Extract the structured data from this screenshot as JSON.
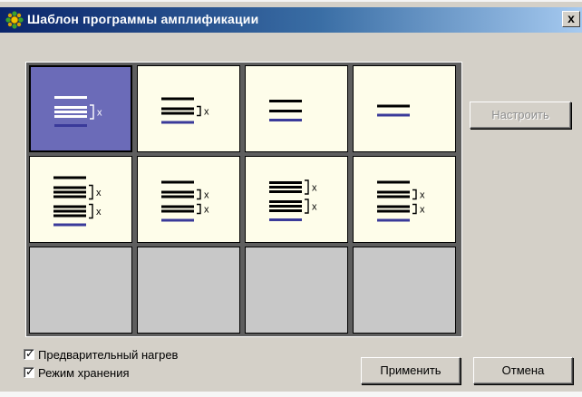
{
  "window": {
    "title": "Шаблон программы амплификации",
    "close_glyph": "x"
  },
  "templates": [
    {
      "id": "t1",
      "selected": true,
      "lines": [
        1,
        3
      ],
      "brackets": [
        1
      ]
    },
    {
      "id": "t2",
      "selected": false,
      "lines": [
        1,
        2
      ],
      "brackets": [
        1
      ]
    },
    {
      "id": "t3",
      "selected": false,
      "lines": [
        1,
        1
      ],
      "brackets": []
    },
    {
      "id": "t4",
      "selected": false,
      "lines": [
        1
      ],
      "brackets": []
    },
    {
      "id": "t5",
      "selected": false,
      "lines": [
        1,
        3,
        3
      ],
      "brackets": [
        1,
        2
      ]
    },
    {
      "id": "t6",
      "selected": false,
      "lines": [
        1,
        2,
        2
      ],
      "brackets": [
        1,
        2
      ]
    },
    {
      "id": "t7",
      "selected": false,
      "lines": [
        3,
        3
      ],
      "brackets": [
        0,
        1
      ]
    },
    {
      "id": "t8",
      "selected": false,
      "lines": [
        1,
        2,
        2
      ],
      "brackets": [
        1,
        2
      ]
    },
    {
      "id": "t9",
      "empty": true
    },
    {
      "id": "t10",
      "empty": true
    },
    {
      "id": "t11",
      "empty": true
    },
    {
      "id": "t12",
      "empty": true
    }
  ],
  "cycle_marker": "x",
  "buttons": {
    "configure": "Настроить",
    "apply": "Применить",
    "cancel": "Отмена"
  },
  "checkboxes": [
    {
      "label": "Предварительный нагрев",
      "checked": true
    },
    {
      "label": "Режим хранения",
      "checked": true
    }
  ],
  "colors": {
    "selected_cell": "#6b6bb8",
    "cell_bg": "#fefdea",
    "empty_cell": "#c8c8c8",
    "blue_line": "#3a3a9a",
    "title_gradient_start": "#0a246a"
  }
}
